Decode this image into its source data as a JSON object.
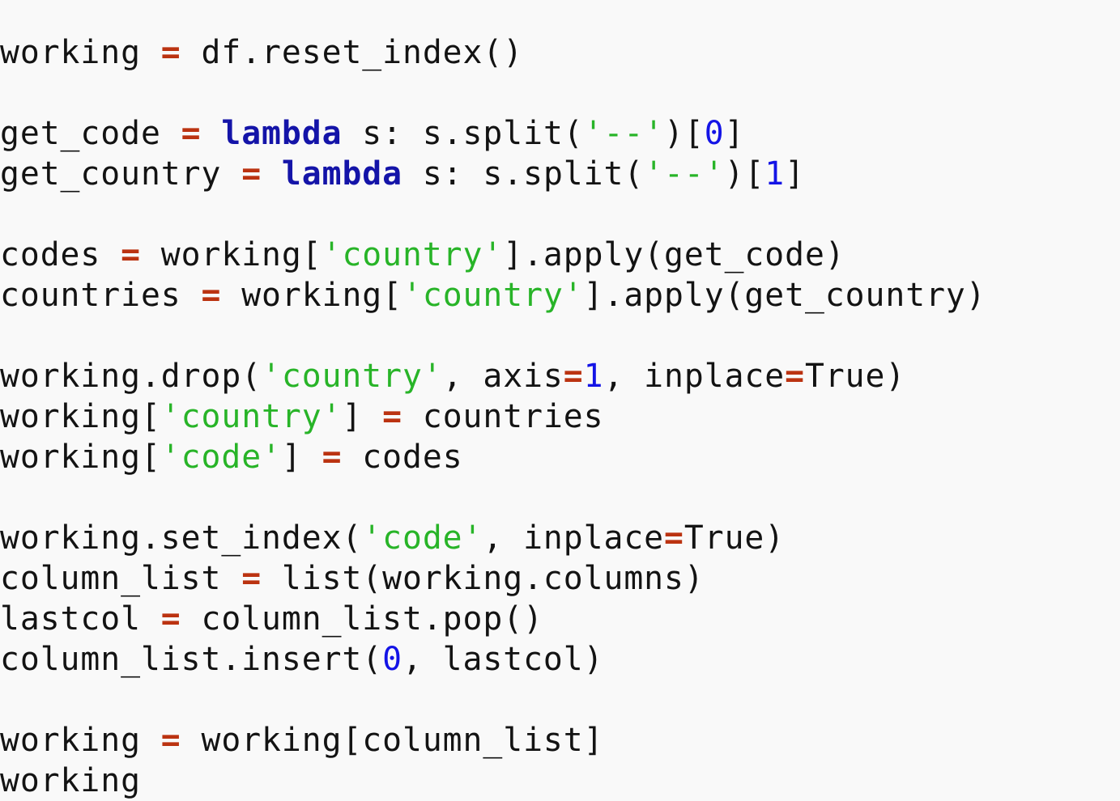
{
  "editor": {
    "language": "python",
    "background_color": "#f9f9f9",
    "foreground_color": "#131313"
  },
  "syntax_colors": {
    "operator": "#bb3311",
    "keyword": "#1414a8",
    "string": "#28b428",
    "number": "#1414e6",
    "plain": "#131313"
  },
  "code": {
    "lines": [
      {
        "index": 0,
        "text": "working = df.reset_index()",
        "tokens": [
          {
            "t": "working ",
            "k": "plain"
          },
          {
            "t": "=",
            "k": "operator"
          },
          {
            "t": " df.reset_index()",
            "k": "plain"
          }
        ]
      },
      {
        "index": 1,
        "text": "",
        "tokens": []
      },
      {
        "index": 2,
        "text": "get_code = lambda s: s.split('--')[0]",
        "tokens": [
          {
            "t": "get_code ",
            "k": "plain"
          },
          {
            "t": "=",
            "k": "operator"
          },
          {
            "t": " ",
            "k": "plain"
          },
          {
            "t": "lambda",
            "k": "keyword"
          },
          {
            "t": " s: s.split(",
            "k": "plain"
          },
          {
            "t": "'--'",
            "k": "string"
          },
          {
            "t": ")[",
            "k": "plain"
          },
          {
            "t": "0",
            "k": "number"
          },
          {
            "t": "]",
            "k": "plain"
          }
        ]
      },
      {
        "index": 3,
        "text": "get_country = lambda s: s.split('--')[1]",
        "tokens": [
          {
            "t": "get_country ",
            "k": "plain"
          },
          {
            "t": "=",
            "k": "operator"
          },
          {
            "t": " ",
            "k": "plain"
          },
          {
            "t": "lambda",
            "k": "keyword"
          },
          {
            "t": " s: s.split(",
            "k": "plain"
          },
          {
            "t": "'--'",
            "k": "string"
          },
          {
            "t": ")[",
            "k": "plain"
          },
          {
            "t": "1",
            "k": "number"
          },
          {
            "t": "]",
            "k": "plain"
          }
        ]
      },
      {
        "index": 4,
        "text": "",
        "tokens": []
      },
      {
        "index": 5,
        "text": "codes = working['country'].apply(get_code)",
        "tokens": [
          {
            "t": "codes ",
            "k": "plain"
          },
          {
            "t": "=",
            "k": "operator"
          },
          {
            "t": " working[",
            "k": "plain"
          },
          {
            "t": "'country'",
            "k": "string"
          },
          {
            "t": "].apply(get_code)",
            "k": "plain"
          }
        ]
      },
      {
        "index": 6,
        "text": "countries = working['country'].apply(get_country)",
        "tokens": [
          {
            "t": "countries ",
            "k": "plain"
          },
          {
            "t": "=",
            "k": "operator"
          },
          {
            "t": " working[",
            "k": "plain"
          },
          {
            "t": "'country'",
            "k": "string"
          },
          {
            "t": "].apply(get_country)",
            "k": "plain"
          }
        ]
      },
      {
        "index": 7,
        "text": "",
        "tokens": []
      },
      {
        "index": 8,
        "text": "working.drop('country', axis=1, inplace=True)",
        "tokens": [
          {
            "t": "working.drop(",
            "k": "plain"
          },
          {
            "t": "'country'",
            "k": "string"
          },
          {
            "t": ", axis",
            "k": "plain"
          },
          {
            "t": "=",
            "k": "operator"
          },
          {
            "t": "1",
            "k": "number"
          },
          {
            "t": ", inplace",
            "k": "plain"
          },
          {
            "t": "=",
            "k": "operator"
          },
          {
            "t": "True)",
            "k": "plain"
          }
        ]
      },
      {
        "index": 9,
        "text": "working['country'] = countries",
        "tokens": [
          {
            "t": "working[",
            "k": "plain"
          },
          {
            "t": "'country'",
            "k": "string"
          },
          {
            "t": "] ",
            "k": "plain"
          },
          {
            "t": "=",
            "k": "operator"
          },
          {
            "t": " countries",
            "k": "plain"
          }
        ]
      },
      {
        "index": 10,
        "text": "working['code'] = codes",
        "tokens": [
          {
            "t": "working[",
            "k": "plain"
          },
          {
            "t": "'code'",
            "k": "string"
          },
          {
            "t": "] ",
            "k": "plain"
          },
          {
            "t": "=",
            "k": "operator"
          },
          {
            "t": " codes",
            "k": "plain"
          }
        ]
      },
      {
        "index": 11,
        "text": "",
        "tokens": []
      },
      {
        "index": 12,
        "text": "working.set_index('code', inplace=True)",
        "tokens": [
          {
            "t": "working.set_index(",
            "k": "plain"
          },
          {
            "t": "'code'",
            "k": "string"
          },
          {
            "t": ", inplace",
            "k": "plain"
          },
          {
            "t": "=",
            "k": "operator"
          },
          {
            "t": "True)",
            "k": "plain"
          }
        ]
      },
      {
        "index": 13,
        "text": "column_list = list(working.columns)",
        "tokens": [
          {
            "t": "column_list ",
            "k": "plain"
          },
          {
            "t": "=",
            "k": "operator"
          },
          {
            "t": " list(working.columns)",
            "k": "plain"
          }
        ]
      },
      {
        "index": 14,
        "text": "lastcol = column_list.pop()",
        "tokens": [
          {
            "t": "lastcol ",
            "k": "plain"
          },
          {
            "t": "=",
            "k": "operator"
          },
          {
            "t": " column_list.pop()",
            "k": "plain"
          }
        ]
      },
      {
        "index": 15,
        "text": "column_list.insert(0, lastcol)",
        "tokens": [
          {
            "t": "column_list.insert(",
            "k": "plain"
          },
          {
            "t": "0",
            "k": "number"
          },
          {
            "t": ", lastcol)",
            "k": "plain"
          }
        ]
      },
      {
        "index": 16,
        "text": "",
        "tokens": []
      },
      {
        "index": 17,
        "text": "working = working[column_list]",
        "tokens": [
          {
            "t": "working ",
            "k": "plain"
          },
          {
            "t": "=",
            "k": "operator"
          },
          {
            "t": " working[column_list]",
            "k": "plain"
          }
        ]
      },
      {
        "index": 18,
        "text": "working",
        "tokens": [
          {
            "t": "working",
            "k": "plain"
          }
        ]
      }
    ]
  }
}
